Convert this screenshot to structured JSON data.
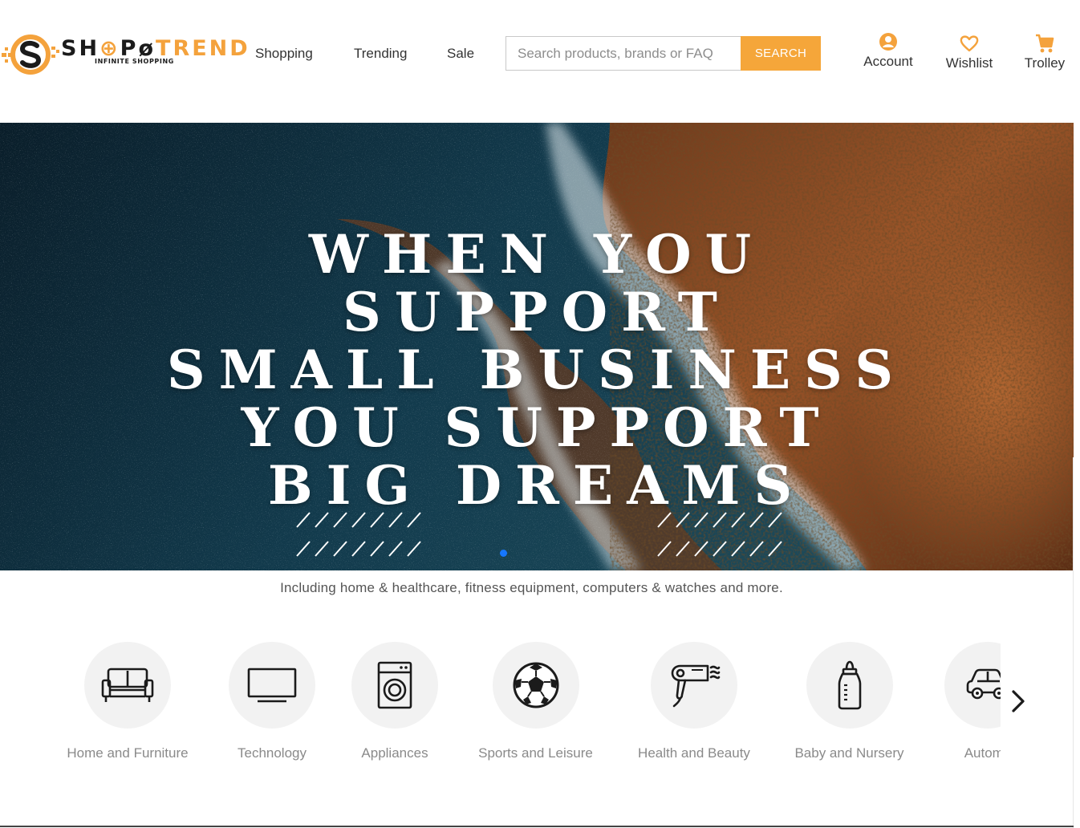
{
  "brand": {
    "logo_dark_1": "SH",
    "logo_dark_2": "P",
    "logo_orange": "TREND",
    "tagline": "INFINITE SHOPPING",
    "accent": "#f5a63a"
  },
  "nav": {
    "items": [
      {
        "label": "Shopping"
      },
      {
        "label": "Trending"
      },
      {
        "label": "Sale"
      }
    ]
  },
  "search": {
    "placeholder": "Search products, brands or FAQ",
    "button_label": "SEARCH"
  },
  "utility": {
    "account": {
      "label": "Account",
      "icon": "user-circle-icon"
    },
    "wishlist": {
      "label": "Wishlist",
      "icon": "heart-icon"
    },
    "trolley": {
      "label": "Trolley",
      "icon": "cart-icon"
    }
  },
  "hero": {
    "lines": [
      "WHEN YOU",
      "SUPPORT",
      "SMALL BUSINESS",
      "YOU SUPPORT",
      "BIG DREAMS"
    ],
    "active_slide": 1,
    "dot_color": "#1677ff"
  },
  "subtext": "Including home & healthcare, fitness equipment, computers & watches and more.",
  "categories": [
    {
      "label": "Home and Furniture",
      "icon": "sofa-icon"
    },
    {
      "label": "Technology",
      "icon": "monitor-icon"
    },
    {
      "label": "Appliances",
      "icon": "washing-machine-icon"
    },
    {
      "label": "Sports and Leisure",
      "icon": "soccer-ball-icon"
    },
    {
      "label": "Health and Beauty",
      "icon": "hair-dryer-icon"
    },
    {
      "label": "Baby and Nursery",
      "icon": "baby-bottle-icon"
    },
    {
      "label": "Automo",
      "icon": "car-icon"
    }
  ]
}
